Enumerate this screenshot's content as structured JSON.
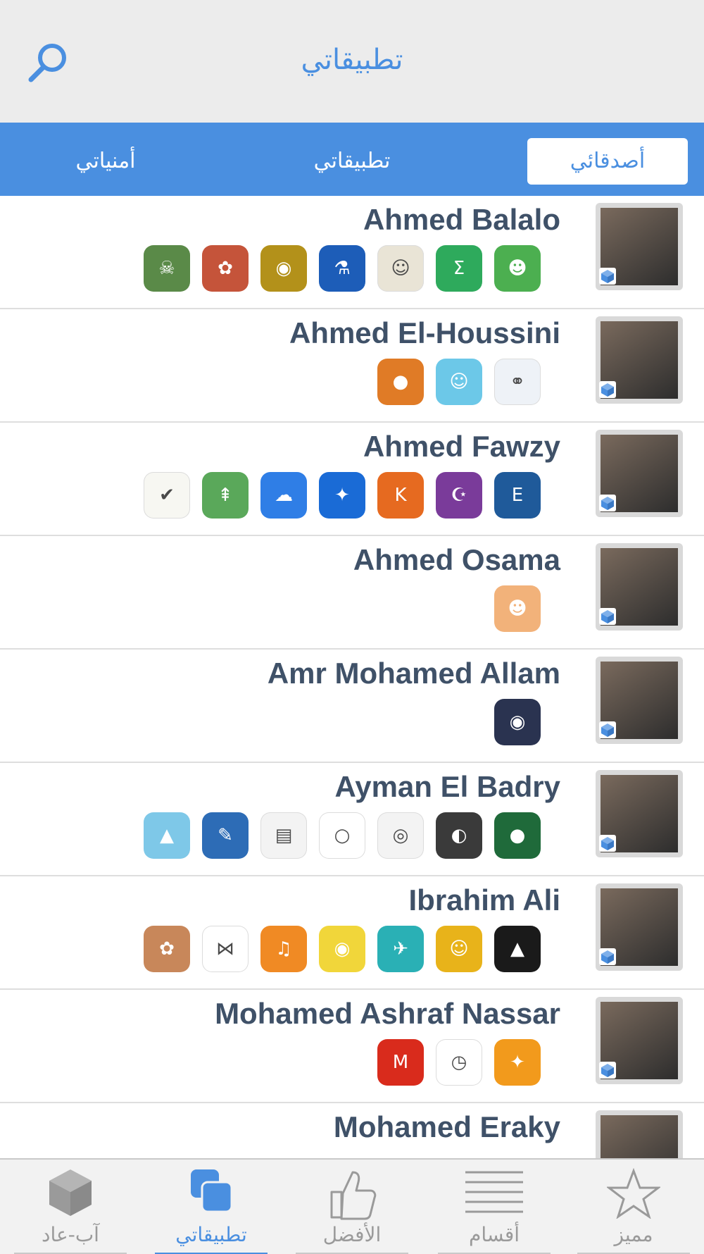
{
  "header": {
    "title": "تطبيقاتي"
  },
  "tabs": [
    {
      "label": "أصدقائي",
      "active": true
    },
    {
      "label": "تطبيقاتي",
      "active": false
    },
    {
      "label": "أمنياتي",
      "active": false
    }
  ],
  "friends": [
    {
      "name": "Ahmed Balalo",
      "apps": [
        {
          "icon": "contacts-app-icon",
          "color": "#4caf50",
          "glyph": "☻"
        },
        {
          "icon": "calculator-sigma-icon",
          "color": "#2eaa5c",
          "glyph": "Σ"
        },
        {
          "icon": "fruit-game-icon",
          "color": "#e9e4d6",
          "glyph": "☺"
        },
        {
          "icon": "lab-flask-icon",
          "color": "#1d5db8",
          "glyph": "⚗"
        },
        {
          "icon": "temple-run-icon",
          "color": "#b3911a",
          "glyph": "◉"
        },
        {
          "icon": "bird-game-icon",
          "color": "#c5543a",
          "glyph": "✿"
        },
        {
          "icon": "zombie-game-icon",
          "color": "#5a8a48",
          "glyph": "☠"
        }
      ]
    },
    {
      "name": "Ahmed El-Houssini",
      "apps": [
        {
          "icon": "connect-circles-icon",
          "color": "#eef2f7",
          "glyph": "⚭"
        },
        {
          "icon": "waze-icon",
          "color": "#6cc8e8",
          "glyph": "☺"
        },
        {
          "icon": "orange-fruit-icon",
          "color": "#e07b26",
          "glyph": "●"
        }
      ]
    },
    {
      "name": "Ahmed Fawzy",
      "apps": [
        {
          "icon": "english-master-icon",
          "color": "#1f5a9a",
          "glyph": "E"
        },
        {
          "icon": "mosque-icon",
          "color": "#7a3b9a",
          "glyph": "☪"
        },
        {
          "icon": "orange-k-icon",
          "color": "#e66a20",
          "glyph": "K"
        },
        {
          "icon": "compass-icon",
          "color": "#1a6bd6",
          "glyph": "✦"
        },
        {
          "icon": "weather-cloud-icon",
          "color": "#2f7ee6",
          "glyph": "☁"
        },
        {
          "icon": "map-road-icon",
          "color": "#5aa85a",
          "glyph": "⇞"
        },
        {
          "icon": "checklist-icon",
          "color": "#f7f7f2",
          "glyph": "✔"
        }
      ]
    },
    {
      "name": "Ahmed Osama",
      "apps": [
        {
          "icon": "happy-face-icon",
          "color": "#f2b27a",
          "glyph": "☻"
        }
      ]
    },
    {
      "name": "Amr Mohamed Allam",
      "apps": [
        {
          "icon": "cat-eye-icon",
          "color": "#2a3350",
          "glyph": "◉"
        }
      ]
    },
    {
      "name": "Ayman El Badry",
      "apps": [
        {
          "icon": "rec-camera-icon",
          "color": "#1f6a3a",
          "glyph": "●"
        },
        {
          "icon": "racing-game-icon",
          "color": "#3a3a3a",
          "glyph": "◐"
        },
        {
          "icon": "camera-lens-icon",
          "color": "#f3f3f3",
          "glyph": "◎"
        },
        {
          "icon": "color-ring-icon",
          "color": "#ffffff",
          "glyph": "○"
        },
        {
          "icon": "slides-icon",
          "color": "#f3f3f3",
          "glyph": "▤"
        },
        {
          "icon": "blueprint-icon",
          "color": "#2d6cb6",
          "glyph": "✎"
        },
        {
          "icon": "landscape-photo-icon",
          "color": "#7ec8e8",
          "glyph": "▲"
        }
      ]
    },
    {
      "name": "Ibrahim Ali",
      "apps": [
        {
          "icon": "mountain-peaks-icon",
          "color": "#1a1a1a",
          "glyph": "▲"
        },
        {
          "icon": "cartoon-game-icon",
          "color": "#e8b31a",
          "glyph": "☺"
        },
        {
          "icon": "bird-fly-icon",
          "color": "#2ab0b5",
          "glyph": "✈"
        },
        {
          "icon": "world-of-goo-icon",
          "color": "#f1d63a",
          "glyph": "◉"
        },
        {
          "icon": "listen-arabic-icon",
          "color": "#f08a24",
          "glyph": "♫"
        },
        {
          "icon": "node-connect-icon",
          "color": "#ffffff",
          "glyph": "⋈"
        },
        {
          "icon": "recipe-box-icon",
          "color": "#c8875a",
          "glyph": "✿"
        }
      ]
    },
    {
      "name": "Mohamed Ashraf Nassar",
      "apps": [
        {
          "icon": "chick-game-icon",
          "color": "#f29a1c",
          "glyph": "✦"
        },
        {
          "icon": "clock-icon",
          "color": "#ffffff",
          "glyph": "◷"
        },
        {
          "icon": "mcdonalds-icon",
          "color": "#d92b1c",
          "glyph": "M"
        }
      ]
    },
    {
      "name": "Mohamed Eraky",
      "apps": []
    }
  ],
  "tabbar": [
    {
      "label": "مميز",
      "icon": "star-icon",
      "active": false
    },
    {
      "label": "أقسام",
      "icon": "list-icon",
      "active": false
    },
    {
      "label": "الأفضل",
      "icon": "thumbs-up-icon",
      "active": false
    },
    {
      "label": "تطبيقاتي",
      "icon": "apps-stack-icon",
      "active": true
    },
    {
      "label": "آب-عاد",
      "icon": "cube-icon",
      "active": false
    }
  ]
}
